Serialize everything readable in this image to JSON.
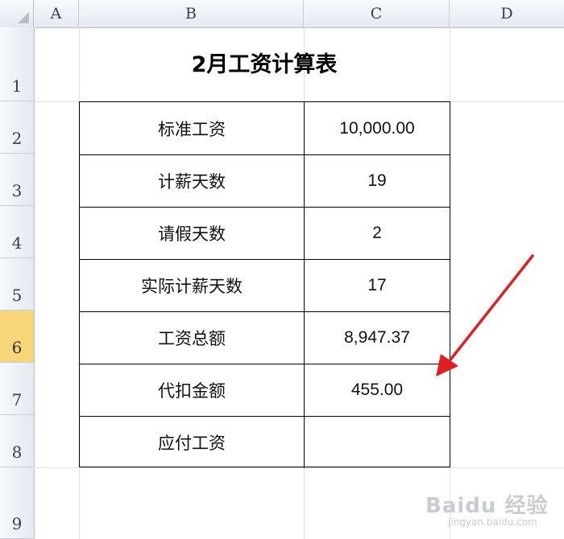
{
  "columns": [
    "A",
    "B",
    "C",
    "D"
  ],
  "rows": [
    "1",
    "2",
    "3",
    "4",
    "5",
    "6",
    "7",
    "8",
    "9"
  ],
  "active_row": "6",
  "title": "2月工资计算表",
  "table": [
    {
      "label": "标准工资",
      "value": "10,000.00"
    },
    {
      "label": "计薪天数",
      "value": "19"
    },
    {
      "label": "请假天数",
      "value": "2"
    },
    {
      "label": "实际计薪天数",
      "value": "17"
    },
    {
      "label": "工资总额",
      "value": "8,947.37"
    },
    {
      "label": "代扣金额",
      "value": "455.00"
    },
    {
      "label": "应付工资",
      "value": ""
    }
  ],
  "watermark": {
    "brand": "Baidu 经验",
    "url": "jingyan.baidu.com"
  },
  "colors": {
    "header_bg": "#e4e9f0",
    "active_row": "#f7d67a",
    "arrow": "#e02020",
    "grid": "#dfe3e8"
  }
}
